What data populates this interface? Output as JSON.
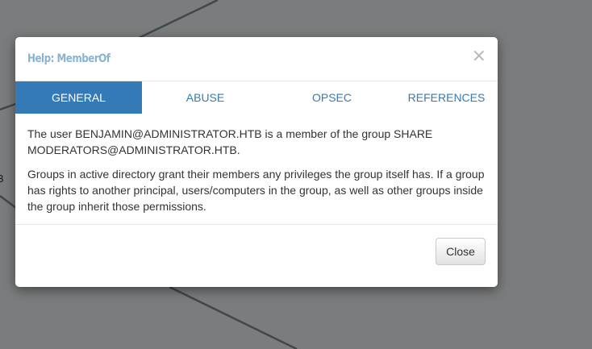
{
  "background": {
    "color": "#7b7c7d",
    "edge_label": "B"
  },
  "modal": {
    "title": "Help: MemberOf",
    "close_icon": "×",
    "tabs": [
      {
        "label": "GENERAL",
        "active": true
      },
      {
        "label": "ABUSE",
        "active": false
      },
      {
        "label": "OPSEC",
        "active": false
      },
      {
        "label": "REFERENCES",
        "active": false
      }
    ],
    "body": {
      "paragraph_1": "The user BENJAMIN@ADMINISTRATOR.HTB is a member of the group SHARE MODERATORS@ADMINISTRATOR.HTB.",
      "paragraph_2": "Groups in active directory grant their members any privileges the group itself has. If a group has rights to another principal, users/computers in the group, as well as other groups inside the group inherit those permissions."
    },
    "footer": {
      "close_label": "Close"
    }
  },
  "colors": {
    "accent": "#337ab7",
    "title": "#89b3cf"
  }
}
